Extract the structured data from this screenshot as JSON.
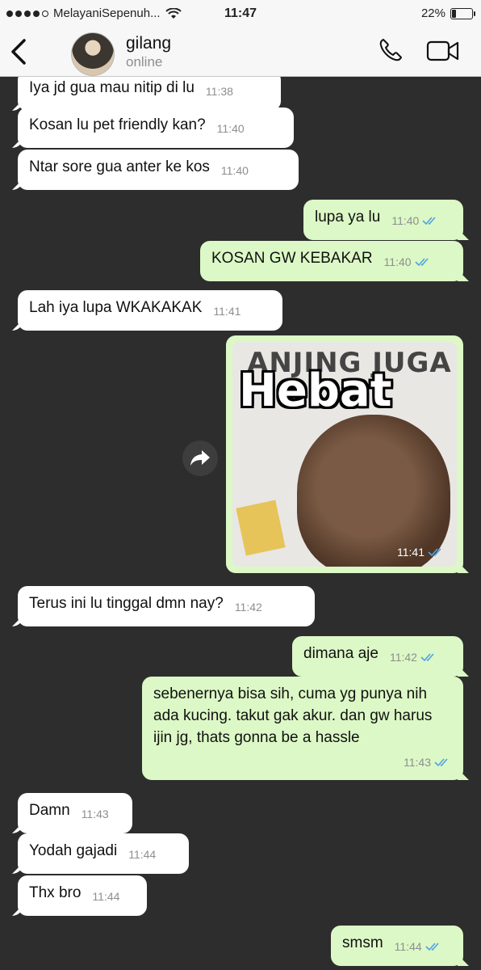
{
  "status_bar": {
    "carrier": "MelayaniSepenuh...",
    "time": "11:47",
    "battery": "22%",
    "signal_icon": "signal-dots-icon",
    "wifi_icon": "wifi-icon",
    "battery_icon": "battery-icon"
  },
  "header": {
    "name": "gilang",
    "status": "online"
  },
  "messages": [
    {
      "dir": "in",
      "text": "Iya jd gua mau nitip di lu",
      "time": "11:38"
    },
    {
      "dir": "in",
      "text": "Kosan lu pet friendly kan?",
      "time": "11:40"
    },
    {
      "dir": "in",
      "text": "Ntar sore gua anter ke kos",
      "time": "11:40"
    },
    {
      "dir": "out",
      "text": "lupa ya lu",
      "time": "11:40"
    },
    {
      "dir": "out",
      "text": "KOSAN GW KEBAKAR",
      "time": "11:40"
    },
    {
      "dir": "in",
      "text": "Lah iya lupa WKAKAKAK",
      "time": "11:41"
    },
    {
      "dir": "out",
      "type": "sticker",
      "time": "11:41"
    },
    {
      "dir": "in",
      "text": "Terus ini lu tinggal dmn nay?",
      "time": "11:42"
    },
    {
      "dir": "out",
      "text": "dimana aje",
      "time": "11:42"
    },
    {
      "dir": "out",
      "text": "sebenernya bisa sih, cuma yg punya nih ada kucing. takut gak akur. dan gw harus ijin jg, thats gonna be a hassle",
      "time": "11:43"
    },
    {
      "dir": "in",
      "text": "Damn",
      "time": "11:43"
    },
    {
      "dir": "in",
      "text": "Yodah gajadi",
      "time": "11:44"
    },
    {
      "dir": "in",
      "text": "Thx bro",
      "time": "11:44"
    },
    {
      "dir": "out",
      "text": "smsm",
      "time": "11:44"
    }
  ],
  "sticker": {
    "top_text": "ANJING JUGA",
    "big_text": "Hebat"
  },
  "colors": {
    "chat_bg": "#2d2d2d",
    "incoming": "#ffffff",
    "outgoing": "#dcf8c6",
    "read_ticks": "#4fa3e0"
  }
}
